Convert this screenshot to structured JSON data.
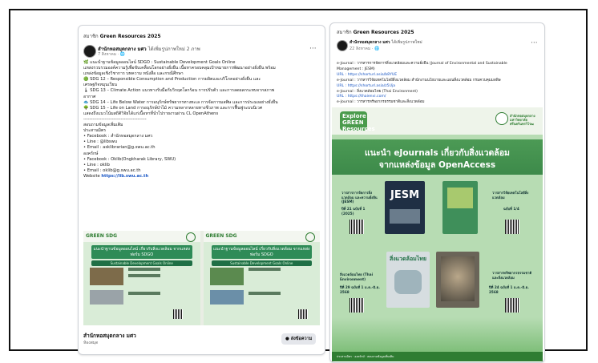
{
  "post1": {
    "group": "Green Resources 2025",
    "group_prefix": "สมาชิก",
    "author": "สำนักหอสมุดกลาง มศว",
    "author_suffix": "ได้เพิ่มรูปภาพใหม่ 2 ภาพ",
    "time": "7 สิงหาคม · 🌐",
    "menu": "···",
    "lines": [
      "🌿 แนะนำฐานข้อมูลออนไลน์ SDGO : Sustainable Development Goals Online",
      "แหล่งรวบรวมองค์ความรู้เพื่อขับเคลื่อนโลกอย่างยั่งยืน เนื้อหาครอบคลุมเป้าหมายการพัฒนาอย่างยั่งยืน พร้อม",
      "แหล่งข้อมูลเชิงวิชาการ บทความ หนังสือ และกรณีศึกษา",
      "🟢 SDG 12 – Responsible Consumption and Production การผลิตและบริโภคอย่างยั่งยืน และ",
      "เศรษฐกิจหมุนเวียน",
      "🌡 SDG 13 – Climate Action แนวทางรับมือกับวิกฤตโลกร้อน การปรับตัว และการลดผลกระทบจากสภาพ",
      "อากาศ",
      "🐟 SDG 14 – Life Below Water การอนุรักษ์ทรัพยากรทางทะเล การจัดการมลพิษ และการประมงอย่างยั่งยืน",
      "🌳 SDG 15 – Life on Land การอนุรักษ์ป่าไม้ ความหลากหลายทางชีวภาพ และการฟื้นฟูระบบนิเวศ",
      "แสดงถึงแนวโน้มสถิติวิจัยได้แก่เนื้อหาที่นำไปรายงานผ่าน CL OpenAthens",
      "------------------------------------------",
      "สอบถามข้อมูลเพิ่มเติม",
      "ประสานมิตร",
      "• Facebook : สำนักหอสมุดกลาง มศว",
      "• Line : @libswu",
      "• Email : asklibrarian@g.swu.ac.th",
      "องครักษ์",
      "• Facebook : Oklib(Ongkharak Library, SWU)",
      "• Line : oklib",
      "• Email : oklib@g.swu.ac.th"
    ],
    "website_label": "Website",
    "website_url": "https://lib.swu.ac.th",
    "poster_logo": "GREEN SDG",
    "poster_banner": "แนะนำฐานข้อมูลออนไลน์ เกี่ยวกับสิ่งแวดล้อม จากแหล่งฟอร์ม SDGO",
    "poster_sub": "Sustainable Development Goals Online",
    "caption": "สำนักหอสมุดกลาง มศว",
    "subcaption": "ห้องสมุด",
    "send_button": "ส่งข้อความ"
  },
  "post2": {
    "group": "Green Resources 2025",
    "group_prefix": "สมาชิก",
    "author": "สำนักหอสมุดกลาง มศว",
    "author_suffix": "ได้เพิ่มรูปภาพใหม่",
    "time": "22 สิงหาคม · 🌐",
    "menu": "···",
    "lines": [
      "e-Journal : วารสารการจัดการสิ่งแวดล้อมและความยั่งยืน (Journal of Environmental and Sustainable",
      "Management : JESM)",
      "URL : https://shorturl.asia/b8YUE",
      "e-Journal : วารสารวิจัยเทคโนโลยีสิ่งแวดล้อม สำนักงานนโยบายและแผนสิ่งแวดล้อม กรมควบคุมมลพิษ",
      "URL : https://shorturl.asia/z5Uja",
      "e-Journal : สิ่งแวดล้อมไทย (Thai Environment)",
      "URL : https://thaienvi.com/",
      "e-Journal : วารสารทรัพยากรธรรมชาติและสิ่งแวดล้อม"
    ],
    "poster_badge": "Explore GREEN Resources",
    "org_name": "สำนักหอสมุดกลาง มหาวิทยาลัยศรีนครินทรวิโรฒ",
    "title1": "แนะนำ eJournals เกี่ยวกับสิ่งแวดล้อม",
    "title2": "จากแหล่งข้อมูล OpenAccess",
    "items": [
      {
        "name": "วารสารการจัดการสิ่งแวดล้อม และความยั่งยืน (JESM)",
        "issue": "ปีที่ 21 ฉบับที่ 1 (2025)"
      },
      {
        "name": "วารสารวิจัยเทคโนโลยีสิ่งแวดล้อม",
        "issue": "ฉบับที่ 1/4"
      },
      {
        "name": "สิ่งแวดล้อมไทย (Thai Environment)",
        "issue": "ปีที่ 29 ฉบับที่ 1 ม.ค.-มิ.ย. 2568"
      },
      {
        "name": "วารสารทรัพยากรธรรมชาติ และสิ่งแวดล้อม",
        "issue": "ปีที่ 24 ฉบับที่ 1 ม.ค.-มิ.ย. 2568"
      }
    ],
    "cover_jesm": "JESM",
    "cover_thai": "สิ่งแวดล้อมไทย",
    "footer": "ประสานมิตร · องครักษ์ · สอบถามข้อมูลเพิ่มเติม"
  },
  "colors": {
    "accent_green": "#2f7d32",
    "link_blue": "#1a57c5"
  }
}
